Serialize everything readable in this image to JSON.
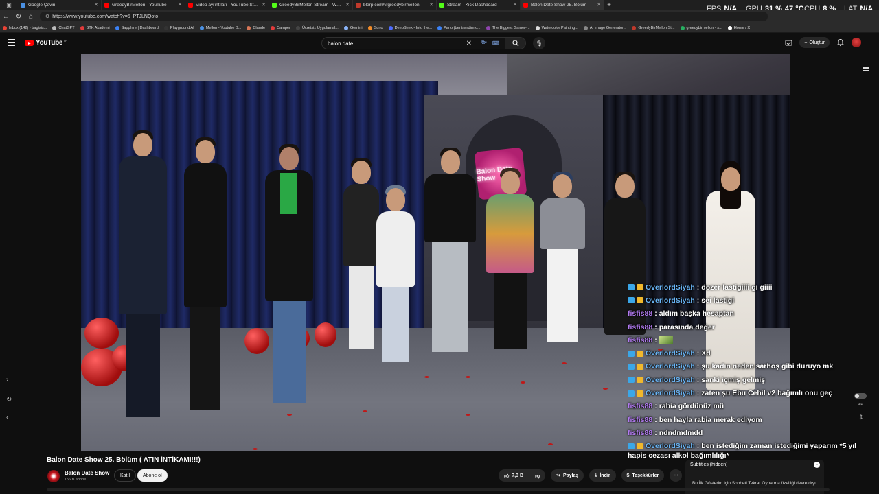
{
  "browser": {
    "tabs": [
      {
        "label": "Google Çeviri",
        "color": "#4a90e2",
        "active": false
      },
      {
        "label": "GreedyBirMellon - YouTube",
        "color": "#ff0000",
        "active": false
      },
      {
        "label": "Video ayrıntıları - YouTube Studio",
        "color": "#ff0000",
        "active": false
      },
      {
        "label": "GreedyBirMellon Stream - Watch",
        "color": "#53fc18",
        "active": false
      },
      {
        "label": "blerp.com/v/greedybirmellon",
        "color": "#c0392b",
        "active": false
      },
      {
        "label": "Stream - Kick Dashboard",
        "color": "#53fc18",
        "active": false
      },
      {
        "label": "Balon Date Show 25. Bölüm",
        "color": "#ff0000",
        "active": true
      }
    ],
    "url": "https://www.youtube.com/watch?v=5_PTJLNQoto",
    "hud": {
      "fps_label": "FPS",
      "fps_value": "N/A",
      "gpu_label": "GPU",
      "gpu_value": "31 %",
      "gpu_temp": "47 °C",
      "cpu_label": "CPU",
      "cpu_value": "8 %",
      "lat_label": "LAT",
      "lat_value": "N/A"
    },
    "bookmarks": [
      {
        "label": "Inbox (142) - bagisis...",
        "color": "#ea4335"
      },
      {
        "label": "ChatGPT",
        "color": "#bbbbbb"
      },
      {
        "label": "BTK Akademi",
        "color": "#e23b3b"
      },
      {
        "label": "Sapphire | Dashboard",
        "color": "#3b82f6"
      },
      {
        "label": "Playground AI",
        "color": "#333333"
      },
      {
        "label": "Mellon - Youtube B...",
        "color": "#4a90e2"
      },
      {
        "label": "Claude",
        "color": "#d97757"
      },
      {
        "label": "Camper",
        "color": "#e23b3b"
      },
      {
        "label": "Ücretsiz Uygulamal...",
        "color": "#444444"
      },
      {
        "label": "Gemini",
        "color": "#8ab4f8"
      },
      {
        "label": "Suno",
        "color": "#f28c28"
      },
      {
        "label": "DeepSeek - Into the...",
        "color": "#4d6bfe"
      },
      {
        "label": "Pano (bentrendim.c...",
        "color": "#3b82f6"
      },
      {
        "label": "The Biggest Gamer-...",
        "color": "#8e44ad"
      },
      {
        "label": "Watercolor Painting...",
        "color": "#dddddd"
      },
      {
        "label": "AI Image Generator...",
        "color": "#888888"
      },
      {
        "label": "GreedyBirMellon St...",
        "color": "#c0392b"
      },
      {
        "label": "greedybirmellon - s...",
        "color": "#27ae60"
      },
      {
        "label": "Home / X",
        "color": "#ffffff"
      }
    ]
  },
  "youtube": {
    "logo_text": "YouTube",
    "country_code": "TR",
    "search_value": "balon date",
    "create_label": "Oluştur"
  },
  "video": {
    "sign_text": "Balon Date Show",
    "title": "Balon Date Show 25. Bölüm ( ATIN İNTİKAMI!!!)",
    "channel_name": "Balon Date Show",
    "subscribers": "156 B abone",
    "join_label": "Katıl",
    "subscribe_label": "Abone ol",
    "likes": "7,3 B",
    "share_label": "Paylaş",
    "download_label": "İndir",
    "thanks_label": "Teşekkürler",
    "autoplay_label": "AP"
  },
  "chat": [
    {
      "user": "OverlordSiyah",
      "color": "blue",
      "badges": true,
      "text": "dozer lastigiiii gı giiii"
    },
    {
      "user": "OverlordSiyah",
      "color": "blue",
      "badges": true,
      "text": "sei lastigi"
    },
    {
      "user": "fisfis88",
      "color": "purple",
      "badges": false,
      "text": "aldım başka hesaptan"
    },
    {
      "user": "fisfis88",
      "color": "purple",
      "badges": false,
      "text": "parasında değer"
    },
    {
      "user": "fisfis88",
      "color": "purple",
      "badges": false,
      "text": "",
      "emote": true
    },
    {
      "user": "OverlordSiyah",
      "color": "blue",
      "badges": true,
      "text": "Xd"
    },
    {
      "user": "OverlordSiyah",
      "color": "blue",
      "badges": true,
      "text": "şu kadın neden sarhoş gibi duruyo mk"
    },
    {
      "user": "OverlordSiyah",
      "color": "blue",
      "badges": true,
      "text": "sanki içmiş gelmiş"
    },
    {
      "user": "OverlordSiyah",
      "color": "blue",
      "badges": true,
      "text": "zaten şu Ebu Cehil v2 bağımlı onu geç"
    },
    {
      "user": "fisfis88",
      "color": "purple",
      "badges": false,
      "text": "rabia gördünüz mü"
    },
    {
      "user": "fisfis88",
      "color": "purple",
      "badges": false,
      "text": "ben hayla rabia merak ediyom"
    },
    {
      "user": "fisfis88",
      "color": "purple",
      "badges": false,
      "text": "ndndmdmdd"
    },
    {
      "user": "OverlordSiyah",
      "color": "blue",
      "badges": true,
      "text": "ben istediğim zaman istediğimi yaparım *5 yıl"
    }
  ],
  "chat_wrap": "hapis cezası alkol bağımlılığı*",
  "subtitles": {
    "header": "Subtitles (hidden)",
    "body": "Bu İlk Gösterim için Sohbeti Tekrar Oynatma özelliği devre dışı"
  }
}
